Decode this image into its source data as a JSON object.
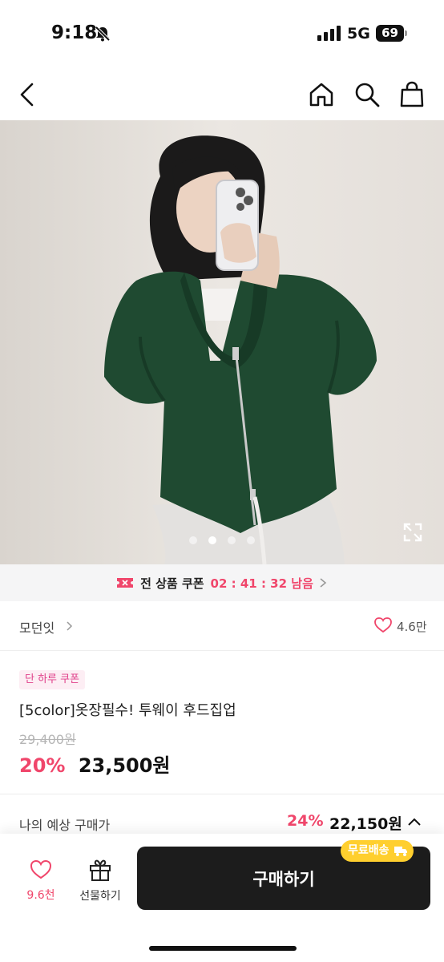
{
  "status_bar": {
    "time": "9:18",
    "network": "5G",
    "battery": "69"
  },
  "nav": {
    "icons": [
      "back-icon",
      "home-icon",
      "search-icon",
      "shopping-bag-icon"
    ]
  },
  "gallery": {
    "slide_count": 4,
    "active_index": 1
  },
  "coupon_banner": {
    "label": "전 상품 쿠폰",
    "timer": "02 : 41 : 32 남음"
  },
  "brand": {
    "name": "모던잇",
    "likes": "4.6만"
  },
  "product": {
    "badge": "단 하루 쿠폰",
    "title": "[5color]옷장필수! 투웨이 후드집업",
    "original_price": "29,400원",
    "discount": "20%",
    "price": "23,500원"
  },
  "expected_price": {
    "label": "나의 예상 구매가",
    "discount": "24%",
    "price": "22,150원"
  },
  "bottom_bar": {
    "wish_count": "9.6천",
    "gift_label": "선물하기",
    "buy_label": "구매하기",
    "free_shipping_label": "무료배송"
  },
  "colors": {
    "accent": "#f0466b",
    "badge_bg": "#fdeef4",
    "buy_button": "#1c1c1c",
    "shipping_badge": "#ffcf2e"
  }
}
